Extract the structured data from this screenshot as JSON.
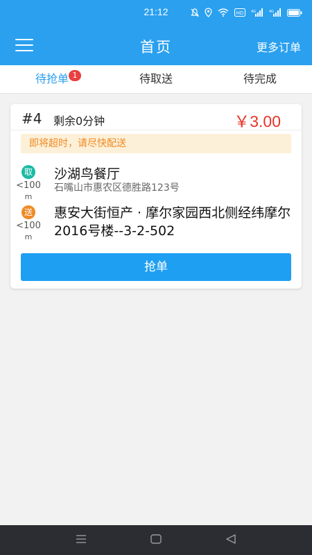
{
  "status_bar": {
    "time": "21:12",
    "icons": [
      "bell-off-icon",
      "location-icon",
      "wifi-icon",
      "hd-icon",
      "signal-icon",
      "signal-icon",
      "battery-icon"
    ]
  },
  "app_bar": {
    "title": "首页",
    "more_label": "更多订单",
    "menu_icon": "hamburger-menu-icon"
  },
  "tabs": [
    {
      "label": "待抢单",
      "badge": "1",
      "active": true
    },
    {
      "label": "待取送",
      "active": false
    },
    {
      "label": "待完成",
      "active": false
    }
  ],
  "order": {
    "number": "#4",
    "remaining": "剩余0分钟",
    "price": "￥3.00",
    "warning": "即将超时，请尽快配送",
    "pickup": {
      "tag": "取",
      "distance": "<100",
      "distance_unit": "m",
      "name": "沙湖鸟餐厅",
      "address": "石嘴山市惠农区德胜路123号"
    },
    "dropoff": {
      "tag": "送",
      "distance": "<100",
      "distance_unit": "m",
      "address": "惠安大街恒产 · 摩尔家园西北侧经纬摩尔2016号楼--3-2-502"
    },
    "grab_label": "抢单"
  },
  "nav_bar": {
    "icons": [
      "recent-apps-icon",
      "home-icon",
      "back-icon"
    ]
  },
  "colors": {
    "primary": "#2aa0ef",
    "price": "#e8332a",
    "warning_text": "#ef8a22",
    "warning_bg": "#fdf0d8",
    "pickup_tag": "#1bbaa4",
    "dropoff_tag": "#f08a26"
  }
}
